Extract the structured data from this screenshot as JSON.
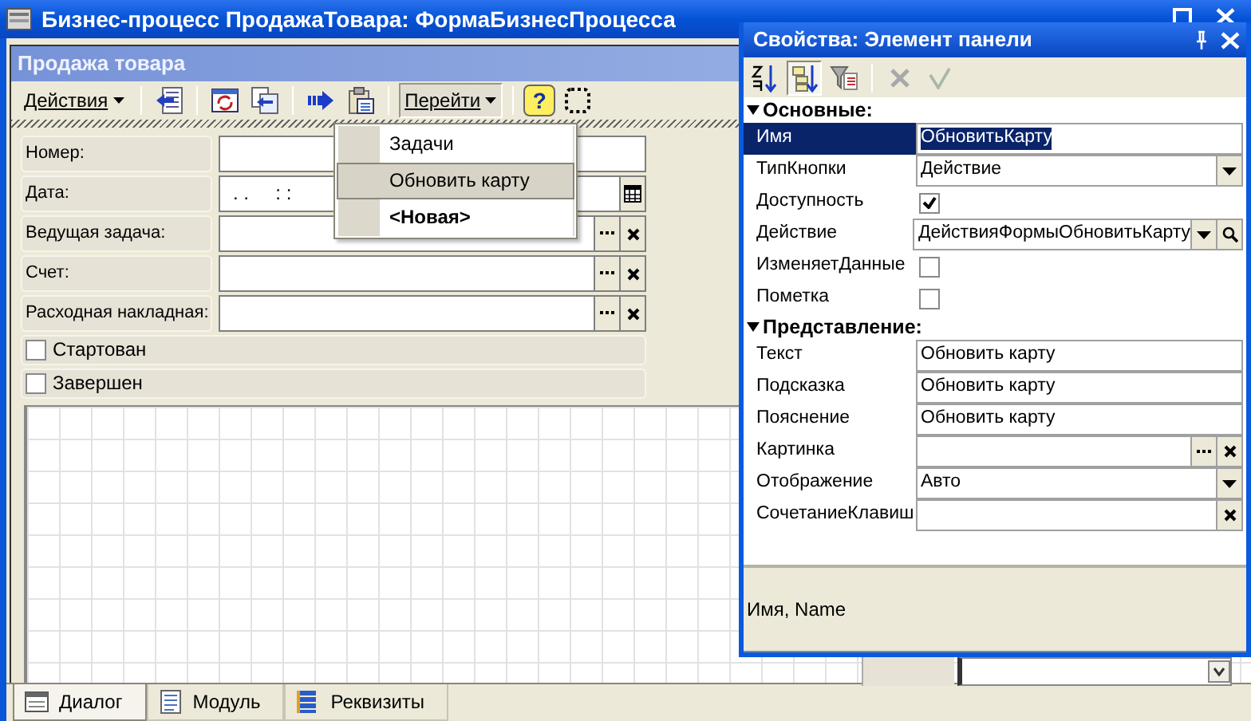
{
  "window": {
    "title": "Бизнес-процесс ПродажаТовара: ФормаБизнесПроцесса"
  },
  "form": {
    "title": "Продажа товара",
    "actions_menu": {
      "label": "Действия"
    },
    "help_button": {
      "label": "?"
    },
    "goto_menu": {
      "label": "Перейти",
      "expanded": true,
      "items": [
        {
          "label": "Задачи",
          "selected": false,
          "bold": false
        },
        {
          "label": "Обновить карту",
          "selected": true,
          "bold": false
        },
        {
          "label": "<Новая>",
          "selected": false,
          "bold": true
        }
      ]
    },
    "fields": [
      {
        "label": "Номер:",
        "kind": "text"
      },
      {
        "label": "Дата:",
        "kind": "date",
        "value": ". .     : :"
      },
      {
        "label": "Ведущая задача:",
        "kind": "reference"
      },
      {
        "label": "Счет:",
        "kind": "reference"
      },
      {
        "label": "Расходная накладная:",
        "kind": "reference"
      }
    ],
    "checkboxes": [
      {
        "label": "Стартован",
        "checked": false
      },
      {
        "label": "Завершен",
        "checked": false
      }
    ]
  },
  "bottom_tabs": [
    {
      "label": "Диалог",
      "selected": true
    },
    {
      "label": "Модуль",
      "selected": false
    },
    {
      "label": "Реквизиты",
      "selected": false
    }
  ],
  "properties": {
    "title": "Свойства: Элемент панели",
    "sections": [
      {
        "title": "Основные:",
        "expanded": true,
        "rows": [
          {
            "name": "Имя",
            "kind": "text",
            "value": "ОбновитьКарту",
            "selected": true
          },
          {
            "name": "ТипКнопки",
            "kind": "combo",
            "value": "Действие",
            "selected": false
          },
          {
            "name": "Доступность",
            "kind": "checkbox",
            "checked": true,
            "selected": false
          },
          {
            "name": "Действие",
            "kind": "combo_search",
            "value": "ДействияФормыОбновитьКарту",
            "selected": false
          },
          {
            "name": "ИзменяетДанные",
            "kind": "checkbox",
            "checked": false,
            "selected": false
          },
          {
            "name": "Пометка",
            "kind": "checkbox",
            "checked": false,
            "selected": false
          }
        ]
      },
      {
        "title": "Представление:",
        "expanded": true,
        "rows": [
          {
            "name": "Текст",
            "kind": "text",
            "value": "Обновить карту",
            "selected": false
          },
          {
            "name": "Подсказка",
            "kind": "text",
            "value": "Обновить карту",
            "selected": false
          },
          {
            "name": "Пояснение",
            "kind": "text",
            "value": "Обновить карту",
            "selected": false
          },
          {
            "name": "Картинка",
            "kind": "reference",
            "selected": false
          },
          {
            "name": "Отображение",
            "kind": "combo",
            "value": "Авто",
            "selected": false
          },
          {
            "name": "СочетаниеКлавиш",
            "kind": "clear",
            "selected": false
          }
        ]
      }
    ],
    "description": "Имя, Name"
  }
}
